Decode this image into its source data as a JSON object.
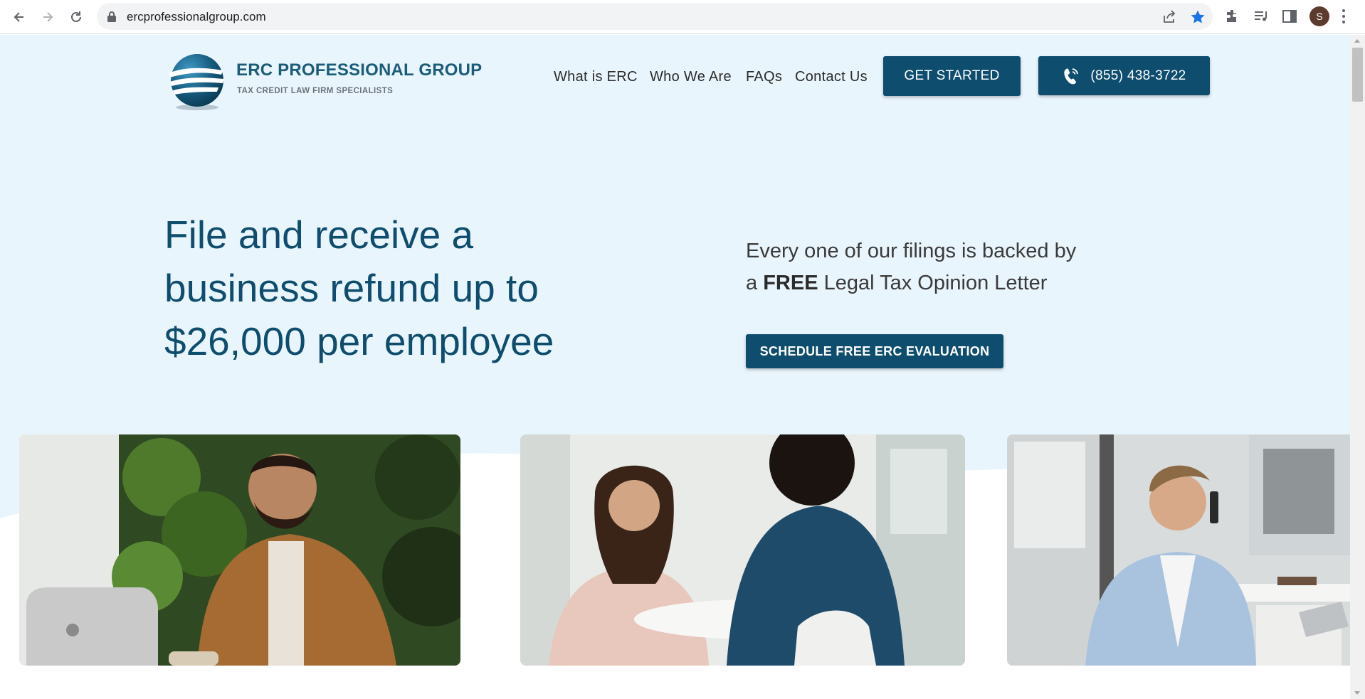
{
  "browser": {
    "url": "ercprofessionalgroup.com",
    "avatar_letter": "S",
    "icons": [
      "back-icon",
      "forward-icon",
      "reload-icon",
      "lock-icon",
      "share-icon",
      "bookmark-star-icon",
      "extensions-icon",
      "media-queue-icon",
      "side-panel-icon",
      "profile-avatar",
      "menu-icon"
    ]
  },
  "header": {
    "logo_title": "ERC PROFESSIONAL GROUP",
    "logo_subtitle": "TAX CREDIT LAW FIRM SPECIALISTS",
    "nav": [
      "What is ERC",
      "Who We Are",
      "FAQs",
      "Contact Us"
    ],
    "get_started": "GET STARTED",
    "phone": "(855) 438-3722"
  },
  "hero": {
    "title_lines": [
      "File and receive a",
      "business refund up to",
      "$26,000 per employee"
    ],
    "subtext_line1": "Every one of our filings is backed by",
    "subtext_prefix": "a ",
    "subtext_bold": "FREE",
    "subtext_suffix": " Legal Tax Opinion Letter",
    "cta": "SCHEDULE FREE ERC EVALUATION"
  },
  "colors": {
    "brand_dark": "#0e4d6e",
    "page_bg": "#e9f5fc",
    "bookmark_star": "#1a73e8"
  }
}
